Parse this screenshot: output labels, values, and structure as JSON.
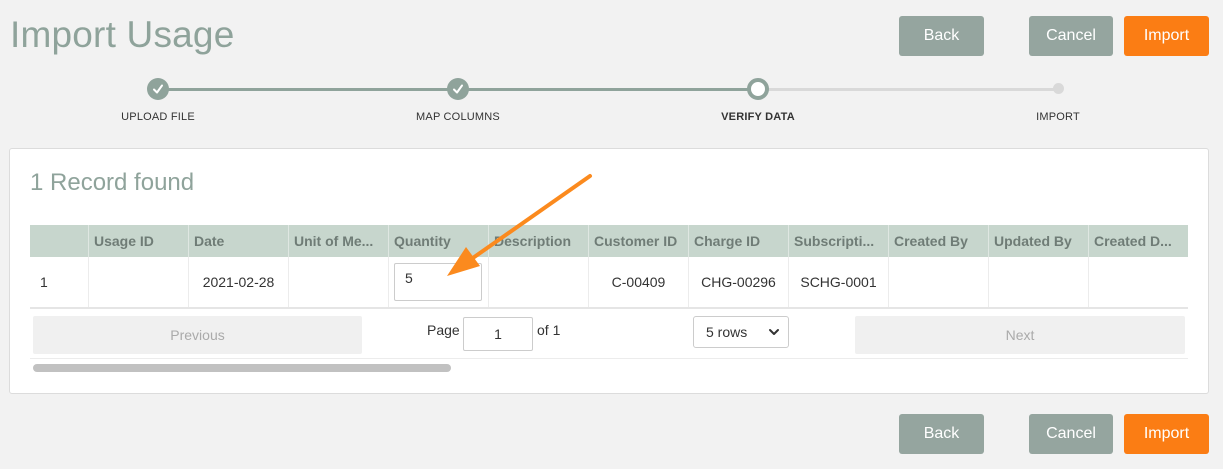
{
  "page": {
    "title": "Import Usage"
  },
  "header_buttons": {
    "back": "Back",
    "cancel": "Cancel",
    "import": "Import"
  },
  "footer_buttons": {
    "back": "Back",
    "cancel": "Cancel",
    "import": "Import"
  },
  "stepper": {
    "steps": [
      {
        "label": "UPLOAD FILE",
        "state": "done"
      },
      {
        "label": "MAP COLUMNS",
        "state": "done"
      },
      {
        "label": "VERIFY DATA",
        "state": "current"
      },
      {
        "label": "IMPORT",
        "state": "todo"
      }
    ]
  },
  "panel": {
    "record_count": "1 Record found"
  },
  "table": {
    "columns": [
      "",
      "Usage ID",
      "Date",
      "Unit of Me...",
      "Quantity",
      "Description",
      "Customer ID",
      "Charge ID",
      "Subscripti...",
      "Created By",
      "Updated By",
      "Created D..."
    ],
    "row": {
      "index": "1",
      "usage_id": "",
      "date": "2021-02-28",
      "unit_of_measure": "",
      "quantity": "5",
      "description": "",
      "customer_id": "C-00409",
      "charge_id": "CHG-00296",
      "subscription": "SCHG-0001",
      "created_by": "",
      "updated_by": "",
      "created_date": ""
    }
  },
  "pagination": {
    "previous": "Previous",
    "page_label": "Page",
    "page_value": "1",
    "of_label": "of 1",
    "rows_option": "5 rows",
    "next": "Next"
  },
  "colors": {
    "accent_orange": "#fb7d14",
    "grey_button": "#95a59f",
    "sage": "#8fa39b",
    "header_row": "#c7d6cd"
  },
  "icons": [
    "check-icon",
    "chevron-down-icon",
    "annotation-arrow"
  ]
}
